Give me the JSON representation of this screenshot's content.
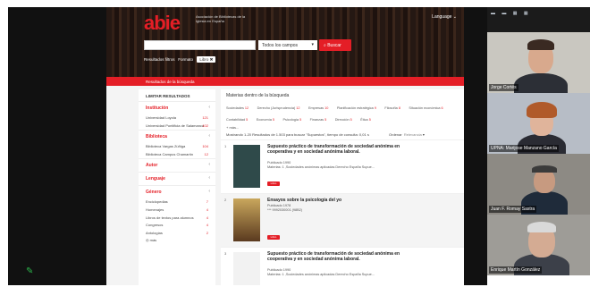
{
  "app": {
    "logo": "abie",
    "logo_subtitle": "Asociación de Bibliotecas de la Iglesia en España",
    "language": "Language ⌄",
    "search_placeholder": "",
    "scope_select": "Todos los campos",
    "search_button": "Buscar",
    "filters_label": "Resultados filtros",
    "filter_prefix": "Formato",
    "filter_tag": "Libro ✖",
    "breadcrumb": "Resultados de la búsqueda"
  },
  "sidebar": {
    "header": "LIMITAR RESULTADOS",
    "sections": [
      {
        "label": "Institución",
        "items": [
          {
            "label": "Universidad Loyola",
            "count": "121"
          },
          {
            "label": "Universidad Pontificia de Salamanca",
            "count": "102"
          }
        ]
      },
      {
        "label": "Biblioteca",
        "items": [
          {
            "label": "Biblioteca Vargas Zúñiga",
            "count": "104"
          },
          {
            "label": "Biblioteca Campus Chamartín",
            "count": "12"
          }
        ]
      },
      {
        "label": "Autor",
        "items": []
      },
      {
        "label": "Lenguaje",
        "items": []
      },
      {
        "label": "Género",
        "items": [
          {
            "label": "Enciclopedias",
            "count": "7"
          },
          {
            "label": "Homenajes",
            "count": "4"
          },
          {
            "label": "Libros de textos para alumnos",
            "count": "4"
          },
          {
            "label": "Congresos",
            "count": "4"
          },
          {
            "label": "Antologías",
            "count": "2"
          }
        ]
      }
    ],
    "more": "más"
  },
  "main": {
    "title": "Materias dentro de la búsqueda",
    "chips": [
      {
        "label": "Sociedades",
        "count": "12"
      },
      {
        "label": "Derecho (Jurisprudencia)",
        "count": "12"
      },
      {
        "label": "Empresas",
        "count": "10"
      },
      {
        "label": "Planificación estratégica",
        "count": "9"
      },
      {
        "label": "Filosofía",
        "count": "8"
      },
      {
        "label": "Situación económica",
        "count": "6"
      },
      {
        "label": "Contabilidad",
        "count": "5"
      },
      {
        "label": "Economía",
        "count": "5"
      },
      {
        "label": "Psicología",
        "count": "5"
      },
      {
        "label": "Finanzas",
        "count": "5"
      },
      {
        "label": "Dirección",
        "count": "5"
      },
      {
        "label": "Ética",
        "count": "5"
      }
    ],
    "more_chips": "+ más...",
    "count_line": "Mostrando 1-20 Resultados de 1.503 para buscar \"Supuestos\", tiempo de consulta: 0,01 s",
    "sort_label": "Ordenar",
    "sort_value": "Relevancia",
    "results": [
      {
        "num": "1",
        "title": "Supuesto práctico de transformación de sociedad anónima en cooperativa y en sociedad anónima laboral.",
        "year": "Publicado 1990",
        "subjects": "Materias: 1 ,Sociedades anónimas aplicadas Derecho España Supue...",
        "format": "Libro"
      },
      {
        "num": "2",
        "title": "Ensayos sobre la psicología del yo",
        "year": "Publicado 1978",
        "subjects": "*** 9992030001 (98B2)",
        "format": "Libro"
      },
      {
        "num": "3",
        "title": "Supuesto práctico de transformación de sociedad anónima en cooperativa y en sociedad anónima laboral.",
        "year": "Publicado 1990",
        "subjects": "Materias: 1 ,Sociedades anónimas aplicadas Derecho España Supue...",
        "format": "Libro"
      }
    ]
  },
  "participants": [
    {
      "name": "Jorge Cortés"
    },
    {
      "name": "UPNA: Marijose Manzano García"
    },
    {
      "name": "Juan F. Romay Sastra"
    },
    {
      "name": "Enrique Martín González"
    }
  ],
  "colors": {
    "brand": "#e41e26",
    "dark": "#111111"
  }
}
